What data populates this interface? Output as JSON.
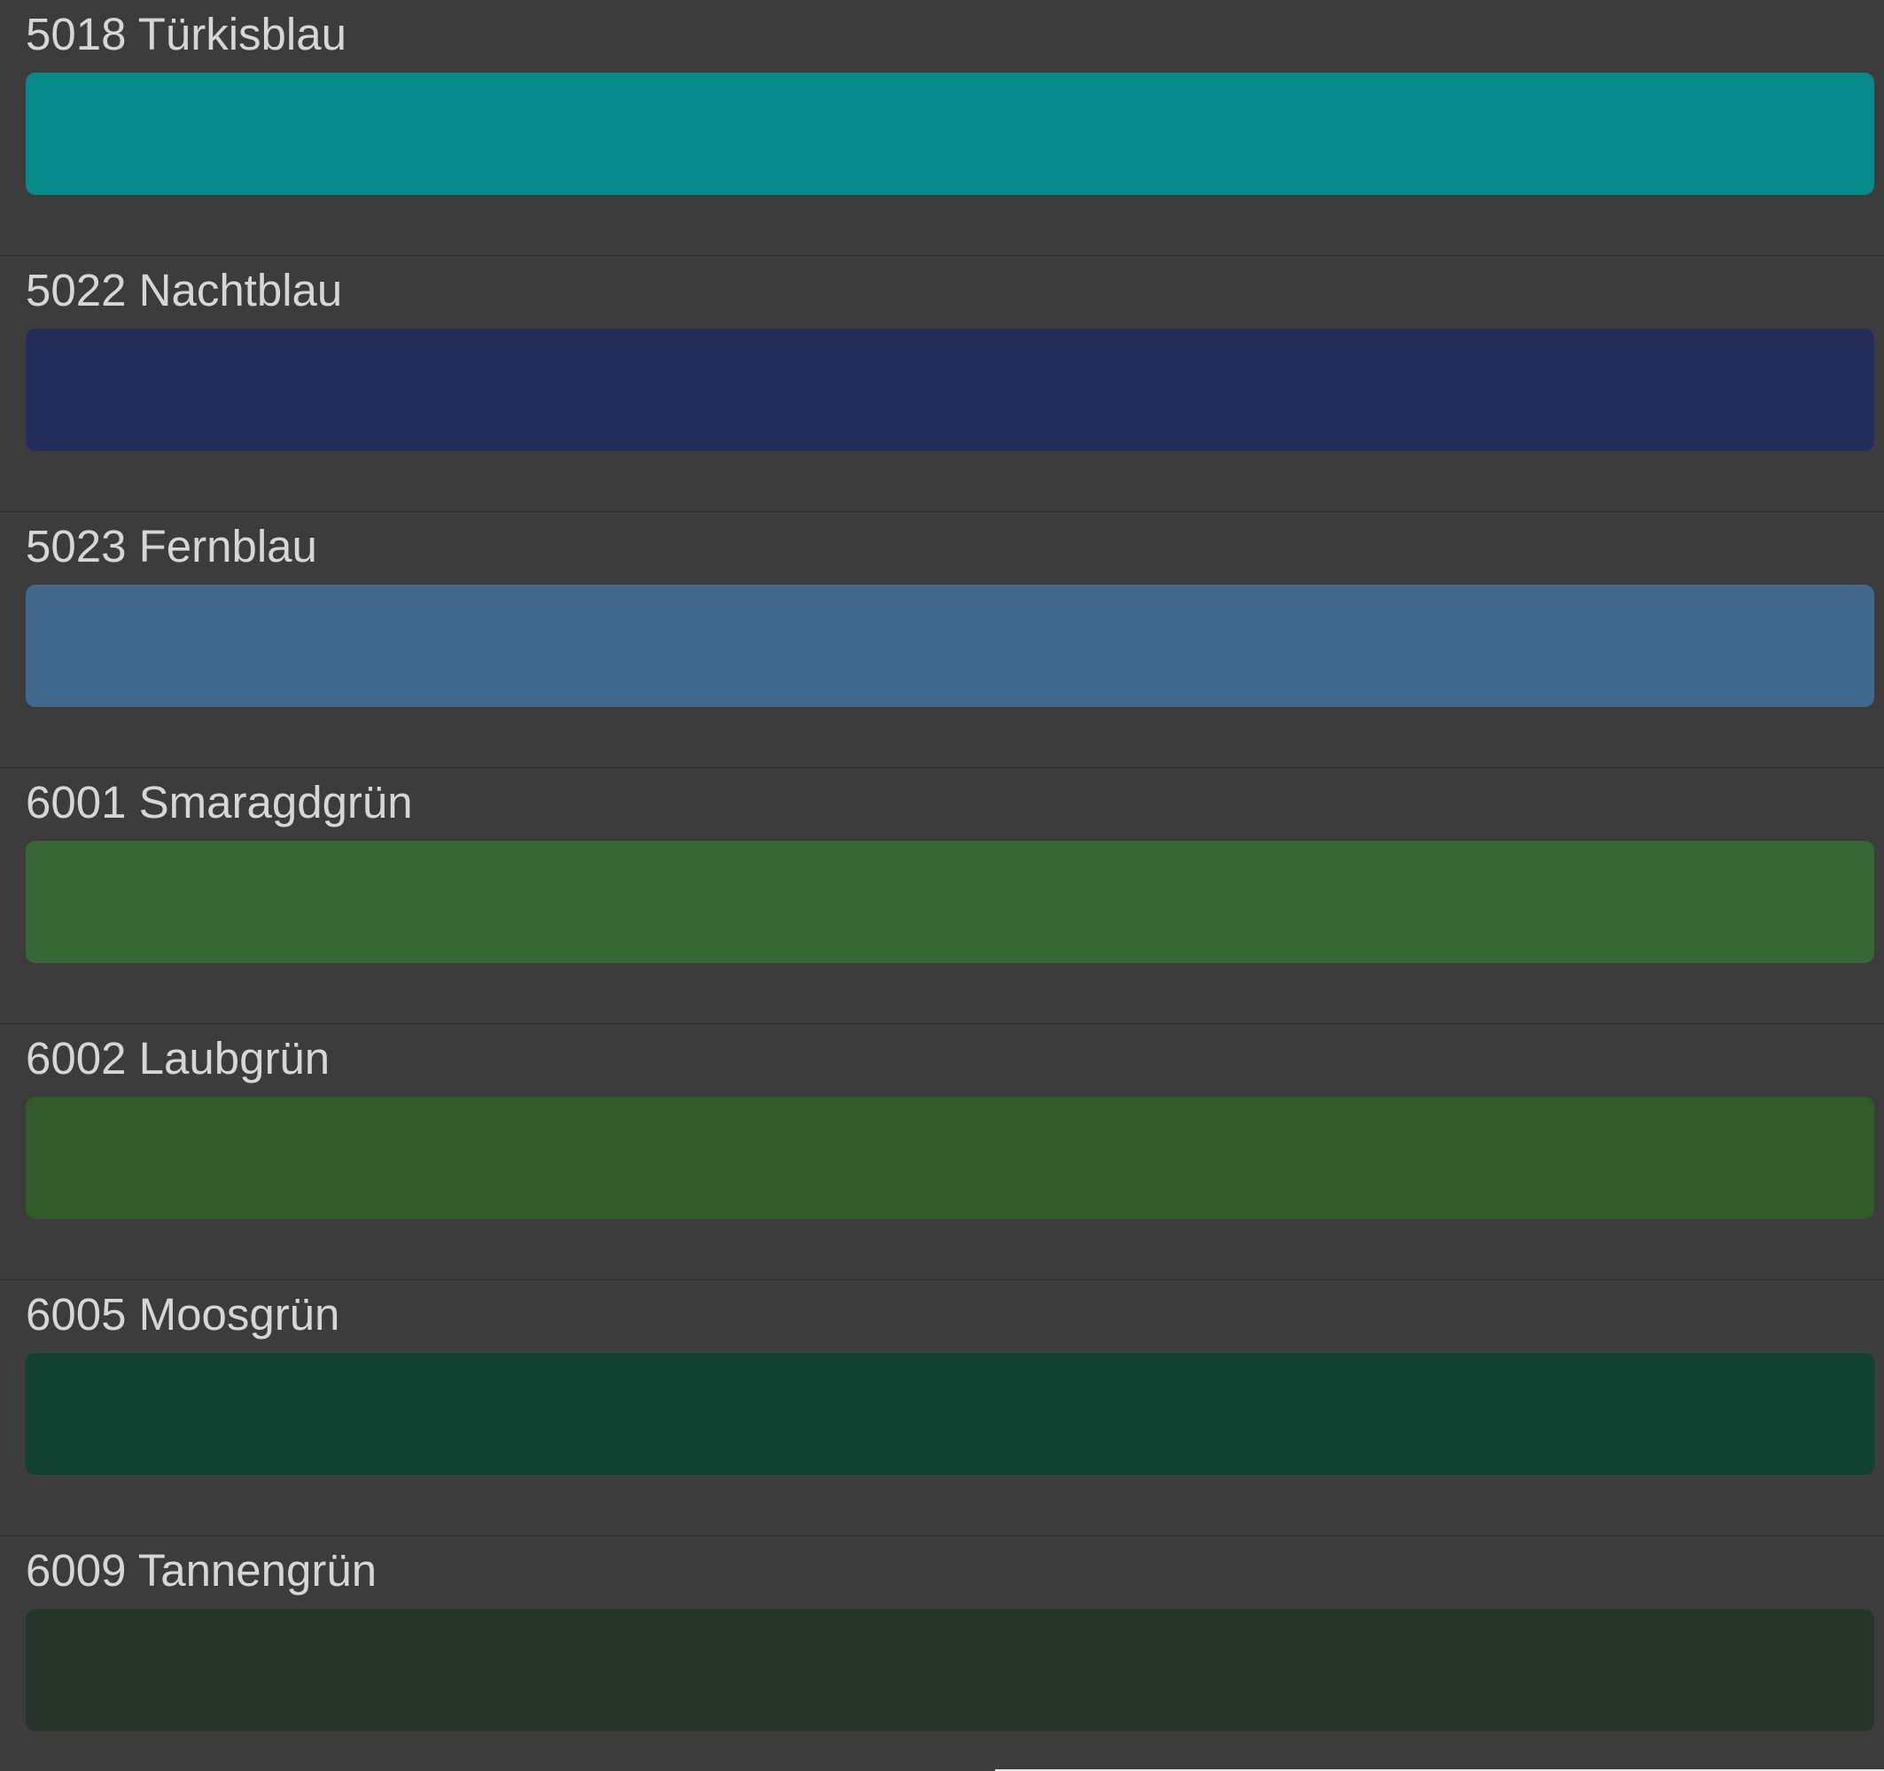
{
  "colors": [
    {
      "label": "5018 Türkisblau",
      "hex": "#058989"
    },
    {
      "label": "5022 Nachtblau",
      "hex": "#222d5a"
    },
    {
      "label": "5023 Fernblau",
      "hex": "#42698c"
    },
    {
      "label": "6001 Smaragdgrün",
      "hex": "#366735"
    },
    {
      "label": "6002 Laubgrün",
      "hex": "#325928"
    },
    {
      "label": "6005 Moosgrün",
      "hex": "#114232"
    },
    {
      "label": "6009 Tannengrün",
      "hex": "#27352a"
    }
  ]
}
